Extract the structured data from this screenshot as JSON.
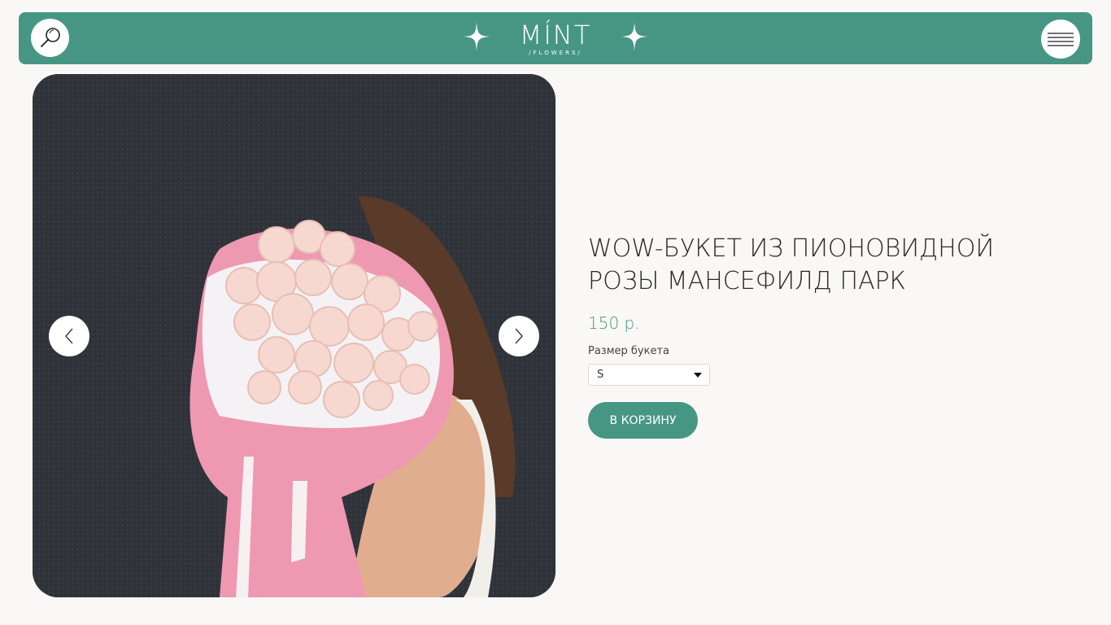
{
  "header": {
    "logo_text": "MÍNT",
    "logo_sub": "/FLOWERS/",
    "search_icon": "search-icon",
    "menu_icon": "hamburger-menu-icon",
    "accent_color": "#479684"
  },
  "gallery": {
    "image_description_icon": "product-photo",
    "prev_icon": "chevron-left-icon",
    "next_icon": "chevron-right-icon"
  },
  "product": {
    "title": "WOW-БУКЕТ ИЗ ПИОНОВИДНОЙ РОЗЫ МАНСЕФИЛД ПАРК",
    "price": "150 р.",
    "size_label": "Размер букета",
    "size_value": "S",
    "add_to_cart_label": "В КОРЗИНУ"
  }
}
